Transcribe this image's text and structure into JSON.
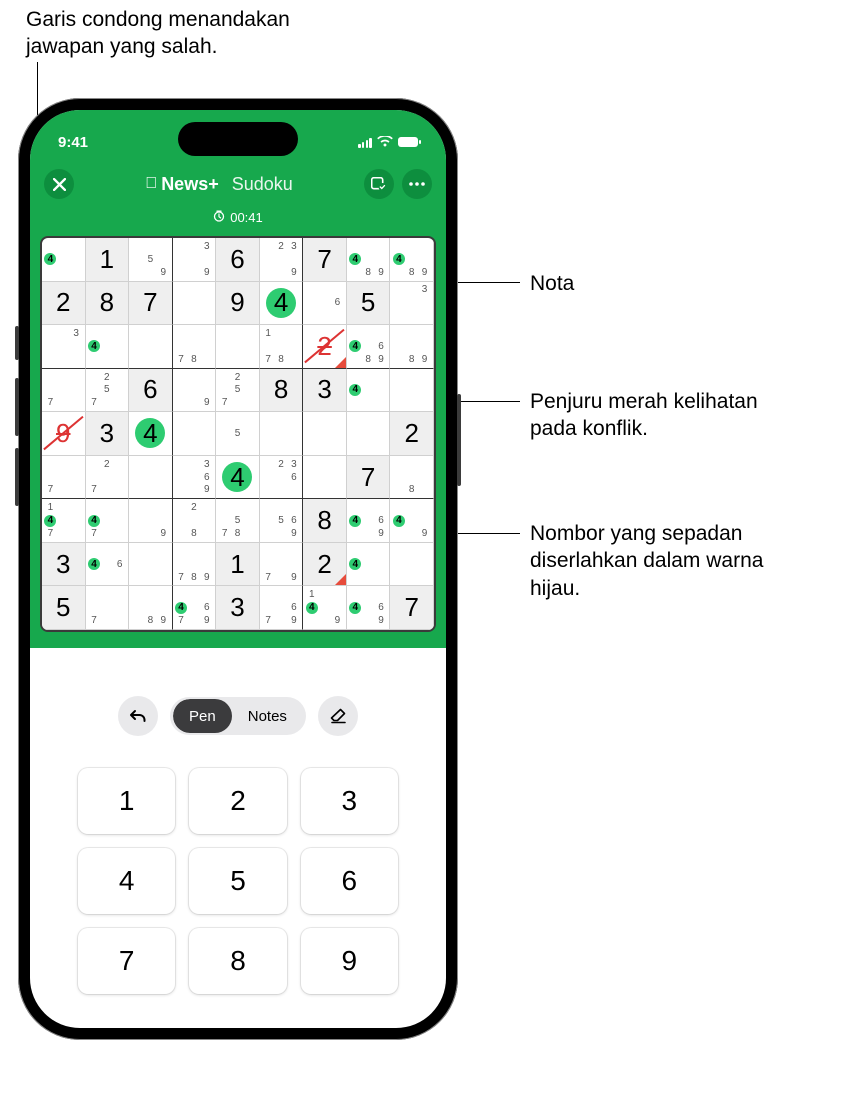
{
  "annotations": {
    "a1": "Garis condong menandakan jawapan yang salah.",
    "a2": "Nota",
    "a3": "Penjuru merah kelihatan pada konflik.",
    "a4": "Nombor yang sepadan diserlahkan dalam warna hijau."
  },
  "statusbar": {
    "time": "9:41"
  },
  "header": {
    "logo1": "News+",
    "logo2": "Sudoku"
  },
  "timer": "00:41",
  "tools": {
    "pen": "Pen",
    "notes": "Notes"
  },
  "keypad": [
    "1",
    "2",
    "3",
    "4",
    "5",
    "6",
    "7",
    "8",
    "9"
  ],
  "selected_number": 4,
  "board": [
    [
      {
        "notes": [
          4
        ],
        "hi": [
          4
        ]
      },
      {
        "v": "1",
        "given": true
      },
      {
        "notes": [
          5,
          9
        ]
      },
      {
        "notes": [
          3,
          9
        ]
      },
      {
        "v": "6",
        "given": true
      },
      {
        "notes": [
          2,
          3,
          9
        ]
      },
      {
        "v": "7",
        "given": true
      },
      {
        "notes": [
          4,
          8,
          9
        ],
        "hi": [
          4
        ]
      },
      {
        "notes": [
          4,
          8,
          9
        ],
        "hi": [
          4
        ]
      }
    ],
    [
      {
        "v": "2",
        "given": true
      },
      {
        "v": "8",
        "given": true
      },
      {
        "v": "7",
        "given": true
      },
      {},
      {
        "v": "9",
        "given": true
      },
      {
        "v": "4",
        "match": true
      },
      {
        "notes": [
          6
        ]
      },
      {
        "v": "5",
        "given": true
      },
      {
        "notes": [
          3
        ]
      }
    ],
    [
      {
        "notes": [
          3
        ]
      },
      {
        "notes": [
          4
        ],
        "hi": [
          4
        ]
      },
      {},
      {
        "notes": [
          7,
          8
        ]
      },
      {},
      {
        "notes": [
          1,
          7,
          8
        ]
      },
      {
        "v": "2",
        "wrong": true,
        "conflict": true
      },
      {
        "notes": [
          4,
          6,
          8,
          9
        ],
        "hi": [
          4
        ]
      },
      {
        "notes": [
          8,
          9
        ]
      }
    ],
    [
      {
        "notes": [
          7
        ]
      },
      {
        "notes": [
          2,
          5,
          7
        ]
      },
      {
        "v": "6",
        "given": true
      },
      {
        "notes": [
          9
        ]
      },
      {
        "notes": [
          2,
          5,
          7
        ]
      },
      {
        "v": "8",
        "given": true
      },
      {
        "v": "3",
        "given": true
      },
      {
        "notes": [
          4
        ],
        "hi": [
          4
        ]
      },
      {}
    ],
    [
      {
        "v": "9",
        "wrong": true
      },
      {
        "v": "3",
        "given": true
      },
      {
        "v": "4",
        "match": true
      },
      {},
      {
        "notes": [
          5
        ]
      },
      {},
      {},
      {},
      {
        "v": "2",
        "given": true
      }
    ],
    [
      {
        "notes": [
          7
        ]
      },
      {
        "notes": [
          2,
          7
        ]
      },
      {},
      {
        "notes": [
          3,
          6,
          9
        ]
      },
      {
        "v": "4",
        "match": true
      },
      {
        "notes": [
          2,
          3,
          6
        ]
      },
      {},
      {
        "v": "7",
        "given": true
      },
      {
        "notes": [
          8
        ]
      }
    ],
    [
      {
        "notes": [
          1,
          4,
          7
        ],
        "hi": [
          4
        ]
      },
      {
        "notes": [
          4,
          7
        ],
        "hi": [
          4
        ]
      },
      {
        "notes": [
          9
        ]
      },
      {
        "notes": [
          2,
          8
        ]
      },
      {
        "notes": [
          5,
          7,
          8
        ]
      },
      {
        "notes": [
          5,
          6,
          9
        ]
      },
      {
        "v": "8",
        "given": true
      },
      {
        "notes": [
          4,
          6,
          9
        ],
        "hi": [
          4
        ]
      },
      {
        "notes": [
          4,
          9
        ],
        "hi": [
          4
        ]
      }
    ],
    [
      {
        "v": "3",
        "given": true
      },
      {
        "notes": [
          4,
          6
        ],
        "hi": [
          4
        ]
      },
      {},
      {
        "notes": [
          7,
          8,
          9
        ]
      },
      {
        "v": "1",
        "given": true
      },
      {
        "notes": [
          7,
          9
        ]
      },
      {
        "v": "2",
        "given": true,
        "conflict": true
      },
      {
        "notes": [
          4
        ],
        "hi": [
          4
        ]
      },
      {}
    ],
    [
      {
        "v": "5",
        "given": true
      },
      {
        "notes": [
          7
        ]
      },
      {
        "notes": [
          8,
          9
        ]
      },
      {
        "notes": [
          4,
          6,
          7,
          9
        ],
        "hi": [
          4
        ]
      },
      {
        "v": "3",
        "given": true
      },
      {
        "notes": [
          6,
          7,
          9
        ]
      },
      {
        "notes": [
          1,
          4,
          9
        ],
        "hi": [
          4
        ]
      },
      {
        "notes": [
          4,
          6,
          9
        ],
        "hi": [
          4
        ]
      },
      {
        "v": "7",
        "given": true
      }
    ]
  ]
}
